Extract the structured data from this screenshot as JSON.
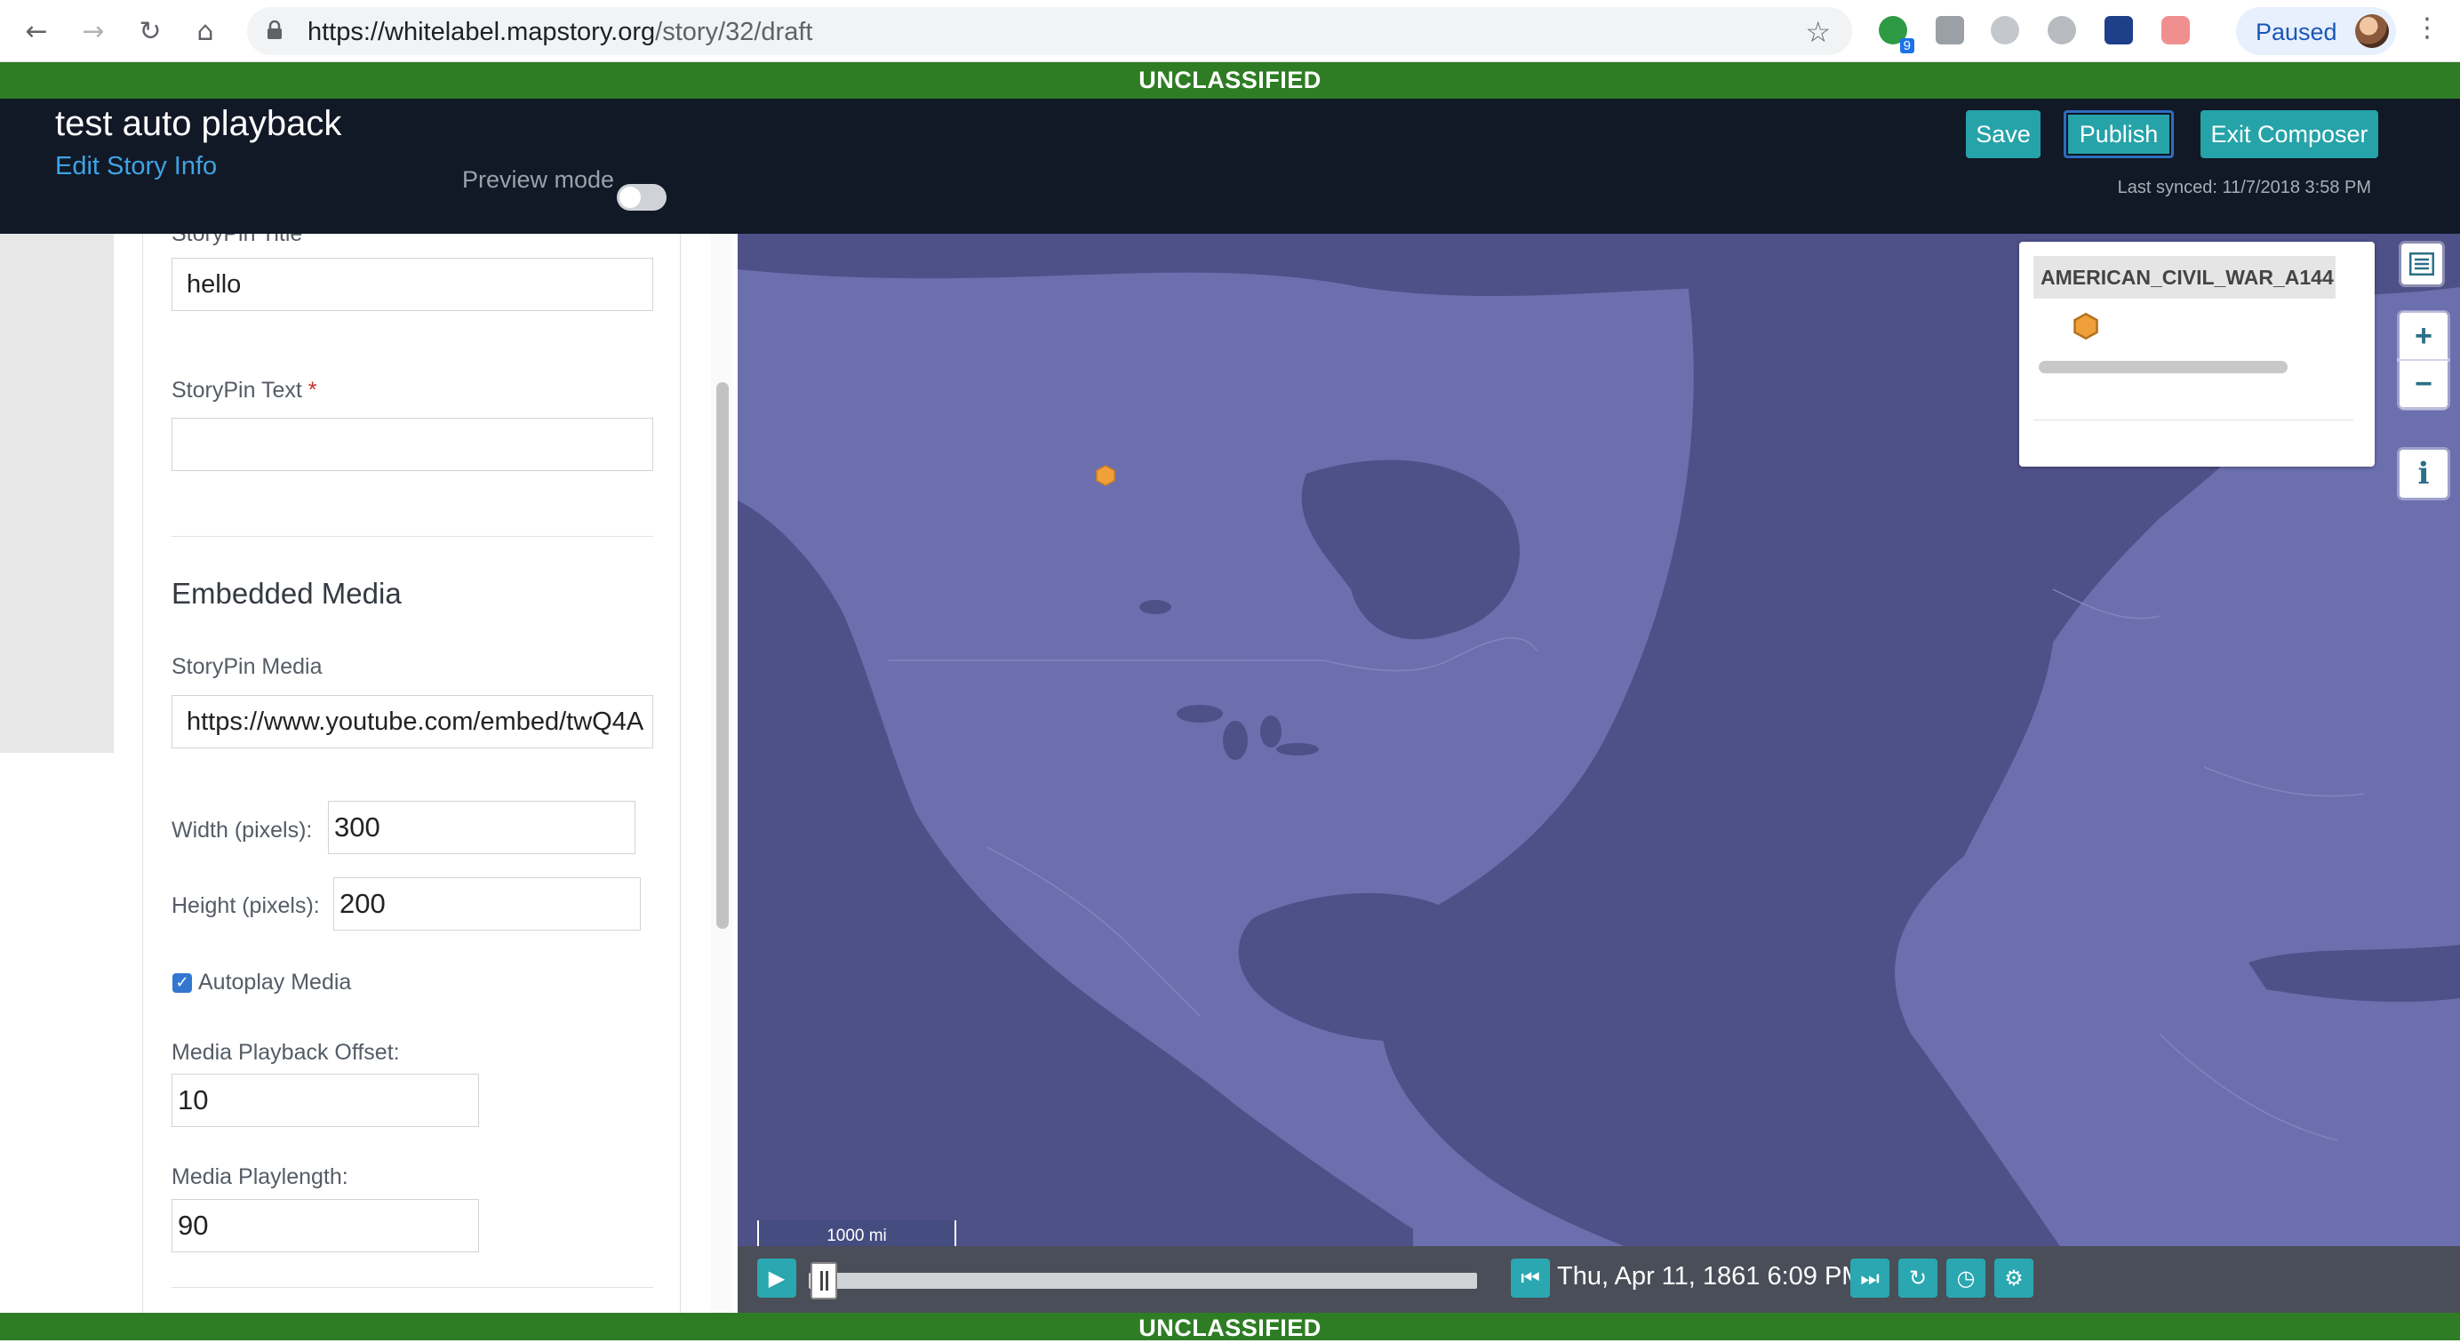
{
  "browser": {
    "url_host": "https://whitelabel.mapstory.org",
    "url_path": "/story/32/draft",
    "extension_badge": "9",
    "profile_label": "Paused"
  },
  "classification": {
    "top": "UNCLASSIFIED",
    "bottom": "UNCLASSIFIED"
  },
  "header": {
    "title": "test auto playback",
    "edit_link": "Edit Story Info",
    "preview_label": "Preview mode",
    "preview_enabled": false,
    "save_label": "Save",
    "publish_label": "Publish",
    "exit_label": "Exit Composer",
    "last_synced": "Last synced: 11/7/2018 3:58 PM"
  },
  "form": {
    "title_label": "StoryPin Title",
    "title_value": "hello",
    "text_label": "StoryPin Text",
    "text_value": "",
    "required_mark": "*",
    "section_title": "Embedded Media",
    "media_label": "StoryPin Media",
    "media_value": "https://www.youtube.com/embed/twQ4A",
    "width_label": "Width (pixels):",
    "width_value": "300",
    "height_label": "Height (pixels):",
    "height_value": "200",
    "autoplay_label": "Autoplay Media",
    "autoplay_checked": true,
    "offset_label": "Media Playback Offset:",
    "offset_value": "10",
    "playlength_label": "Media Playlength:",
    "playlength_value": "90"
  },
  "map": {
    "legend_layer": "AMERICAN_CIVIL_WAR_A144",
    "zoom_in": "+",
    "zoom_out": "−",
    "info": "i",
    "scale_label": "1000 mi",
    "current_date": "Thu, Apr 11, 1861 6:09 PM",
    "colors": {
      "land": "#6c6fae",
      "water": "#4d4f86",
      "marker": "#f0a03a"
    }
  }
}
